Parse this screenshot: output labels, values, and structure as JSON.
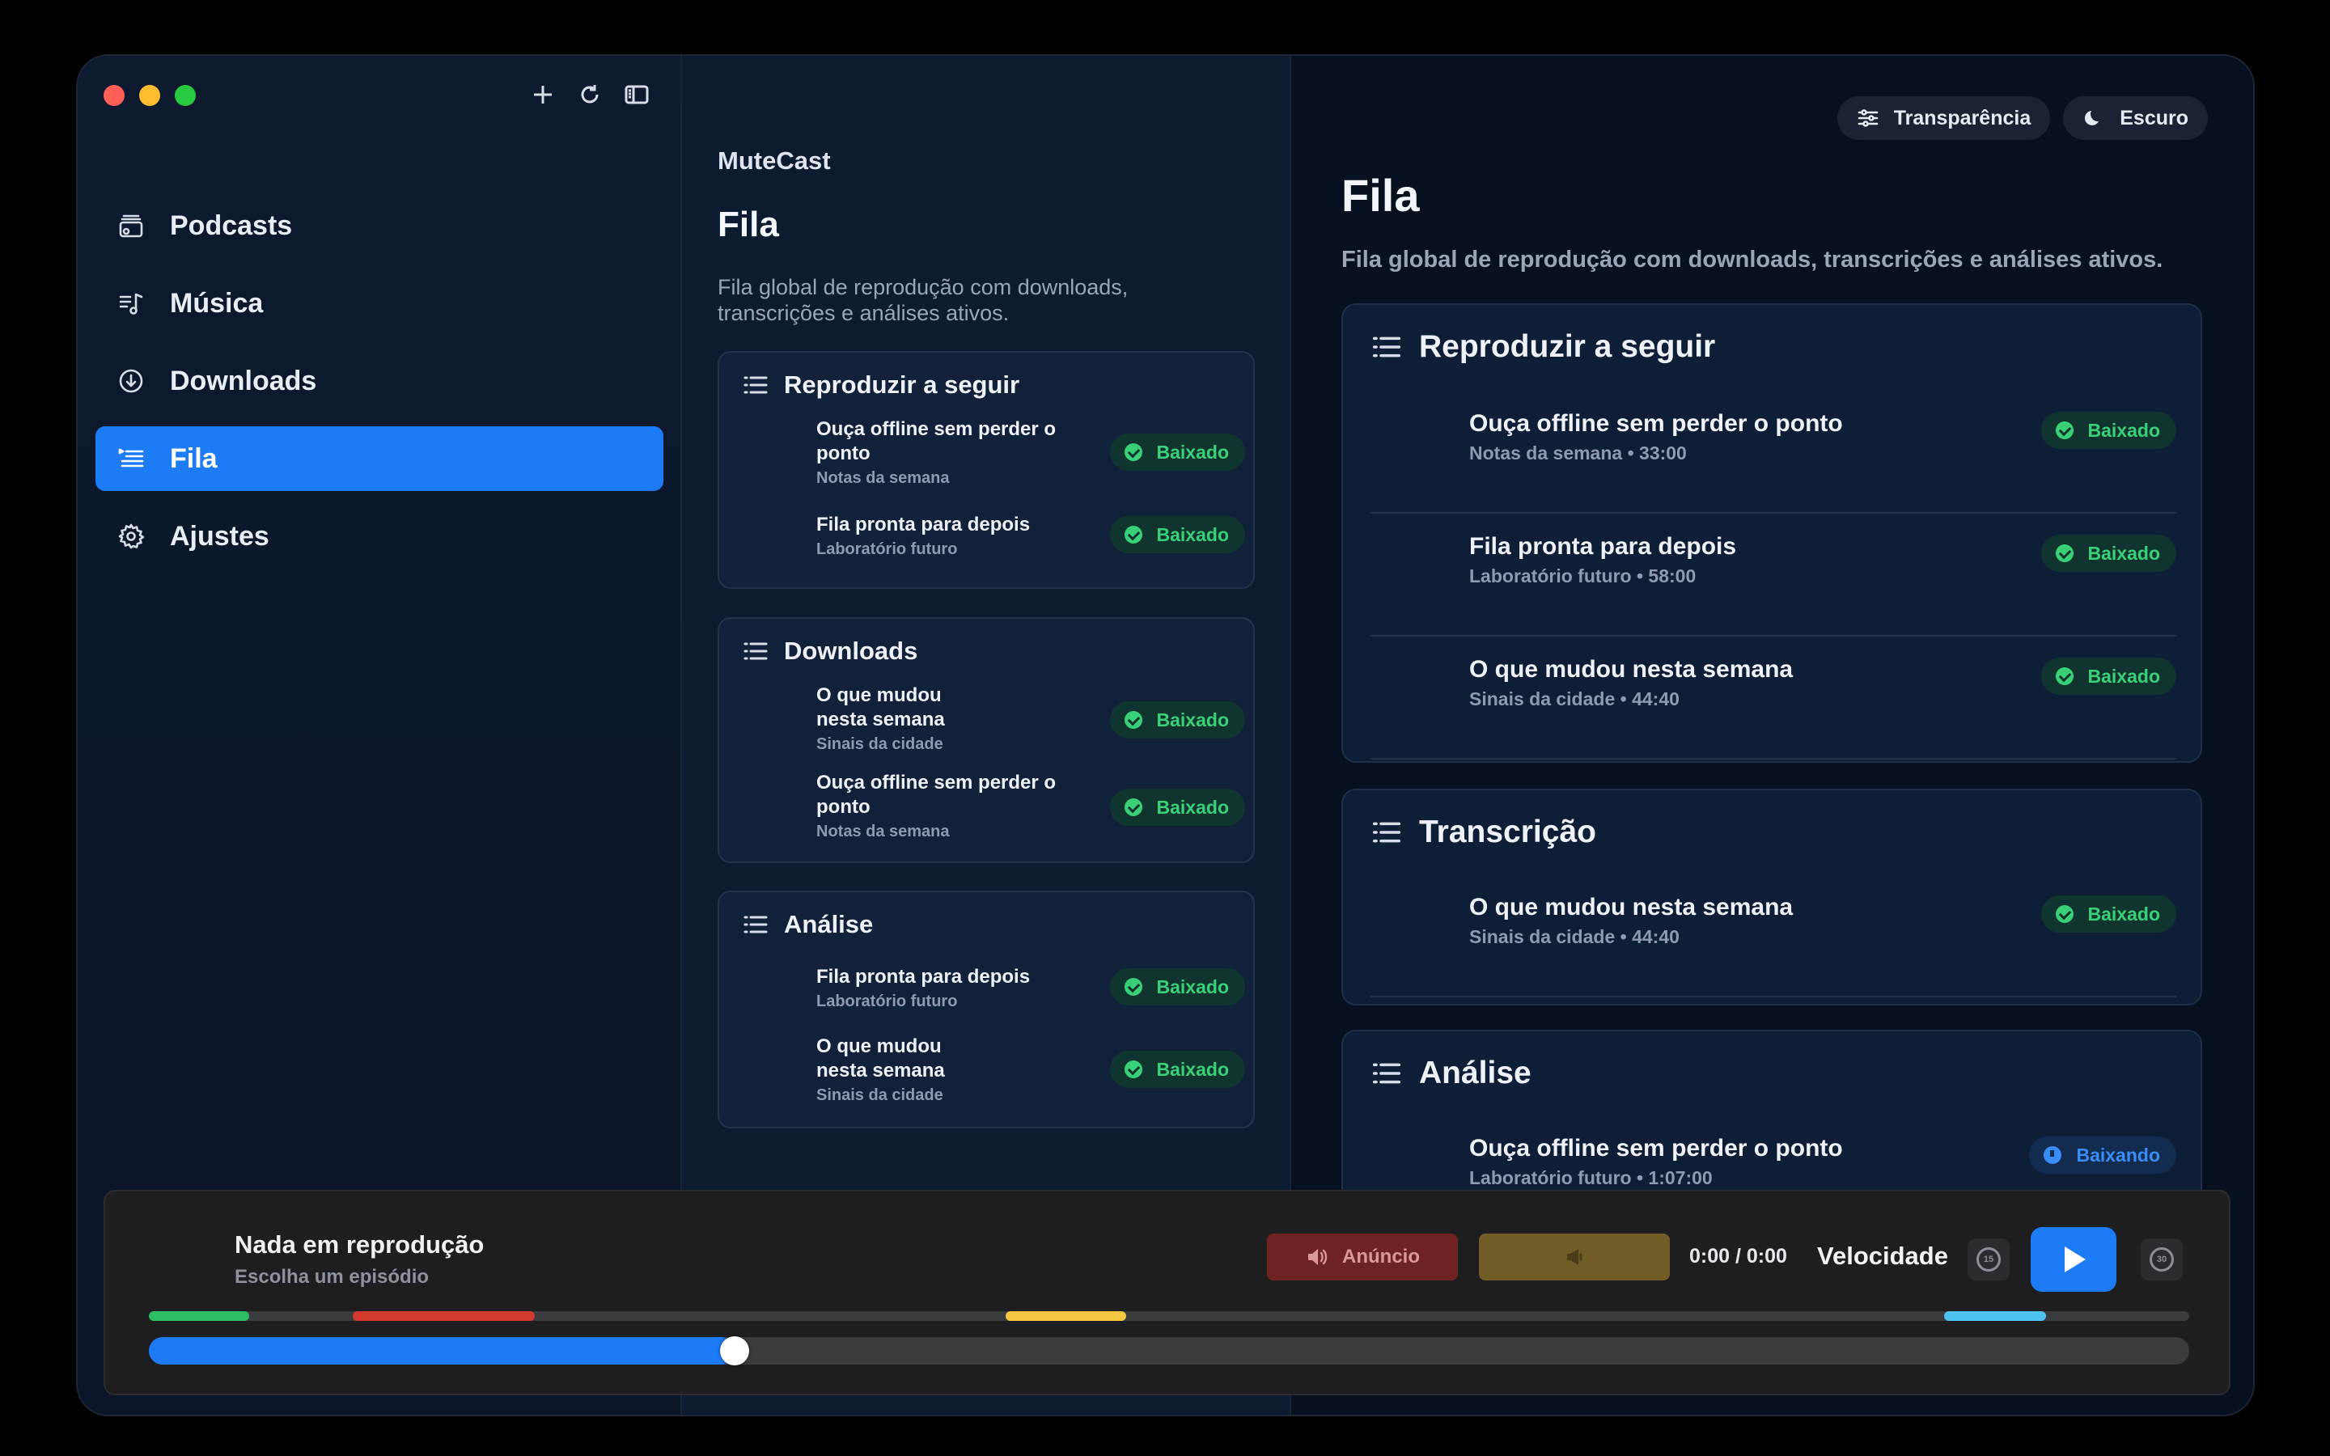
{
  "sidebar": {
    "items": [
      {
        "label": "Podcasts",
        "icon": "podcast-stack-icon"
      },
      {
        "label": "Música",
        "icon": "music-note-icon"
      },
      {
        "label": "Downloads",
        "icon": "download-circle-icon"
      },
      {
        "label": "Fila",
        "icon": "queue-list-icon",
        "active": true
      },
      {
        "label": "Ajustes",
        "icon": "gear-icon"
      }
    ]
  },
  "middle": {
    "app_name": "MuteCast",
    "title": "Fila",
    "subtitle": "Fila global de reprodução com downloads, transcrições e análises ativos.",
    "cards": [
      {
        "title": "Reproduzir a seguir",
        "rows": [
          {
            "title": "Ouça offline sem perder o ponto",
            "sub": "Notas da semana",
            "status": "Baixado"
          },
          {
            "title": "Fila pronta para depois",
            "sub": "Laboratório futuro",
            "status": "Baixado"
          }
        ]
      },
      {
        "title": "Downloads",
        "rows": [
          {
            "title": "O que mudou nesta semana",
            "sub": "Sinais da cidade",
            "status": "Baixado"
          },
          {
            "title": "Ouça offline sem perder o ponto",
            "sub": "Notas da semana",
            "status": "Baixado"
          }
        ]
      },
      {
        "title": "Análise",
        "rows": [
          {
            "title": "Fila pronta para depois",
            "sub": "Laboratório futuro",
            "status": "Baixado"
          },
          {
            "title": "O que mudou nesta semana",
            "sub": "Sinais da cidade",
            "status": "Baixado"
          }
        ]
      }
    ]
  },
  "right": {
    "toolbar": {
      "transparency": "Transparência",
      "theme": "Escuro"
    },
    "title": "Fila",
    "subtitle": "Fila global de reprodução com downloads, transcrições e análises ativos.",
    "cards": [
      {
        "title": "Reproduzir a seguir",
        "rows": [
          {
            "title": "Ouça offline sem perder o ponto",
            "sub": "Notas da semana • 33:00",
            "status": "Baixado"
          },
          {
            "title": "Fila pronta para depois",
            "sub": "Laboratório futuro • 58:00",
            "status": "Baixado"
          },
          {
            "title": "O que mudou nesta semana",
            "sub": "Sinais da cidade • 44:40",
            "status": "Baixado"
          }
        ]
      },
      {
        "title": "Transcrição",
        "rows": [
          {
            "title": "O que mudou nesta semana",
            "sub": "Sinais da cidade • 44:40",
            "status": "Baixado"
          }
        ]
      },
      {
        "title": "Análise",
        "rows": [
          {
            "title": "Ouça offline sem perder o ponto",
            "sub": "Laboratório futuro • 1:07:00",
            "status": "Baixando"
          }
        ]
      }
    ]
  },
  "player": {
    "title": "Nada em reprodução",
    "subtitle": "Escolha um episódio",
    "ad_label": "Anúncio",
    "time": "0:00 / 0:00",
    "speed_label": "Velocidade",
    "skip_back": "15",
    "skip_forward": "30",
    "progress": 0.28,
    "segments": [
      {
        "start": 0.0,
        "end": 0.049,
        "color": "#2dbd63"
      },
      {
        "start": 0.1,
        "end": 0.189,
        "color": "#d33a2f"
      },
      {
        "start": 0.42,
        "end": 0.479,
        "color": "#f5c843"
      },
      {
        "start": 0.88,
        "end": 0.93,
        "color": "#4fc3f0"
      }
    ]
  },
  "colors": {
    "accent": "#1d7cf5",
    "success": "#3ad07a",
    "downloading": "#3a8cf7"
  }
}
